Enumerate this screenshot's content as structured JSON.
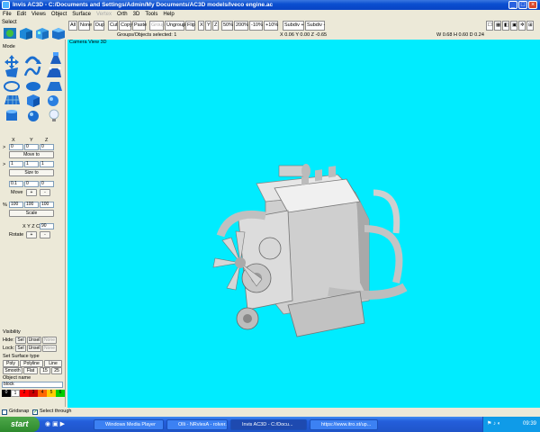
{
  "window": {
    "title": "Invis AC3D - C:/Documents and Settings/Admin/My Documents/AC3D models/Iveco engine.ac"
  },
  "menu": [
    "File",
    "Edit",
    "Views",
    "Object",
    "Surface",
    "Vertex",
    "Orth",
    "3D",
    "Tools",
    "Help"
  ],
  "toolbar": {
    "select_label": "Select",
    "buttons": [
      "All",
      "None",
      "Dup",
      "Cut",
      "Copy",
      "Paste",
      "Group",
      "Ungroup",
      "Flip",
      "X",
      "Y",
      "Z",
      "50%",
      "200%",
      "-10%",
      "+10%",
      "Subdiv +",
      "Subdiv -"
    ]
  },
  "status": {
    "selected": "Groups/Objects selected: 1",
    "position": "X 0.06 Y 0.00 Z -0.65",
    "size": "W 0.68 H 0.60 D 0.24"
  },
  "viewport": {
    "camera_label": "Camera View 3D"
  },
  "panel": {
    "mode_label": "Mode",
    "xyz": [
      "X",
      "Y",
      "Z"
    ],
    "move_values": [
      "0",
      "0",
      "0"
    ],
    "move_to": "Move to",
    "size_values": [
      "1",
      "1",
      "1"
    ],
    "size_to": "Size to",
    "move_step_values": [
      "0.1",
      "0",
      "0"
    ],
    "move_label": "Move",
    "plus": "+",
    "minus": "-",
    "pct": "%",
    "scale_values": [
      "100",
      "100",
      "100"
    ],
    "scale_label": "Scale",
    "rot_axes": "X Y Z C",
    "rot_value": "90",
    "rotate_label": "Rotate",
    "visibility": "Visibility",
    "hide": "Hide:",
    "lock": "Lock:",
    "sel": "Sel",
    "unsel": "Unsel",
    "none": "None",
    "surface_type": "Set Surface type",
    "poly": "Poly",
    "polyline": "Polyline",
    "line": "Line",
    "smooth": "Smooth",
    "flat": "Flat",
    "n15": "15",
    "n25": "25",
    "object_name_label": "Object name",
    "object_name": "block"
  },
  "palette": {
    "colors": [
      "#000000",
      "#ffffff",
      "#ff0000",
      "#cc0000",
      "#ff6600",
      "#ffcc00",
      "#00cc00"
    ],
    "labels": [
      "0",
      "1",
      "2",
      "3",
      "4",
      "5",
      "6"
    ]
  },
  "bottom": {
    "gridsnap": "Gridsnap",
    "select_through": "Select through"
  },
  "taskbar": {
    "start": "start",
    "tasks": [
      "Windows Media Player",
      "Olli - NRvlesA - rolver...",
      "Invis AC3D - C:/Docu...",
      "https://www.itro.st/up..."
    ],
    "clock": "09:39"
  }
}
